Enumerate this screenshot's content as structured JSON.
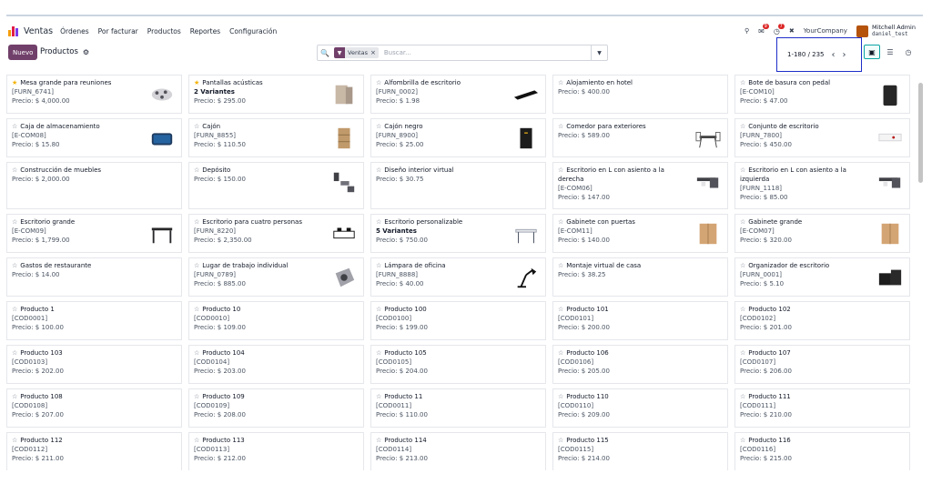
{
  "navbar": {
    "brand": "Ventas",
    "menu": [
      "Órdenes",
      "Por facturar",
      "Productos",
      "Reportes",
      "Configuración"
    ],
    "company": "YourCompany",
    "user_name": "Mitchell Admin",
    "db_name": "daniel_test",
    "chat_count": "9",
    "activity_count": "7"
  },
  "control": {
    "new_label": "Nuevo",
    "breadcrumb": "Productos",
    "facet_label": "Ventas",
    "search_placeholder": "Buscar...",
    "pager": "1-180 / 235"
  },
  "colors": {
    "accent": "#71406a",
    "favorite": "#f3b200",
    "pager_highlight": "#1d2ec9"
  },
  "products": [
    {
      "name": "Mesa grande para reuniones",
      "sub": "[FURN_6741]",
      "price": "Precio: $ 4,000.00",
      "fav": true,
      "thumb": "meeting-table"
    },
    {
      "name": "Pantallas acústicas",
      "sub": "2 Variantes",
      "sub_bold": true,
      "price": "Precio: $ 295.00",
      "fav": true,
      "thumb": "acoustic-panel"
    },
    {
      "name": "Alfombrilla de escritorio",
      "sub": "[FURN_0002]",
      "price": "Precio: $ 1.98",
      "thumb": "desk-pad"
    },
    {
      "name": "Alojamiento en hotel",
      "sub": "",
      "price": "Precio: $ 400.00",
      "thumb": ""
    },
    {
      "name": "Bote de basura con pedal",
      "sub": "[E-COM10]",
      "price": "Precio: $ 47.00",
      "thumb": "trash-can"
    },
    {
      "name": "Caja de almacenamiento",
      "sub": "[E-COM08]",
      "price": "Precio: $ 15.80",
      "thumb": "storage-box"
    },
    {
      "name": "Cajón",
      "sub": "[FURN_8855]",
      "price": "Precio: $ 110.50",
      "thumb": "drawer"
    },
    {
      "name": "Cajón negro",
      "sub": "[FURN_8900]",
      "price": "Precio: $ 25.00",
      "thumb": "black-drawer"
    },
    {
      "name": "Comedor para exteriores",
      "sub": "",
      "price": "Precio: $ 589.00",
      "thumb": "outdoor-dining"
    },
    {
      "name": "Conjunto de escritorio",
      "sub": "[FURN_7800]",
      "price": "Precio: $ 450.00",
      "thumb": "desk-set"
    },
    {
      "name": "Construcción de muebles",
      "sub": "",
      "price": "Precio: $ 2,000.00",
      "thumb": ""
    },
    {
      "name": "Depósito",
      "sub": "",
      "price": "Precio: $ 150.00",
      "thumb": "deposit"
    },
    {
      "name": "Diseño interior virtual",
      "sub": "",
      "price": "Precio: $ 30.75",
      "thumb": ""
    },
    {
      "name": "Escritorio en L con asiento a la derecha",
      "sub": "[E-COM06]",
      "price": "Precio: $ 147.00",
      "thumb": "l-desk",
      "tall": true
    },
    {
      "name": "Escritorio en L con asiento a la izquierda",
      "sub": "[FURN_1118]",
      "price": "Precio: $ 85.00",
      "thumb": "l-desk",
      "tall": true
    },
    {
      "name": "Escritorio grande",
      "sub": "[E-COM09]",
      "price": "Precio: $ 1,799.00",
      "thumb": "large-desk"
    },
    {
      "name": "Escritorio para cuatro personas",
      "sub": "[FURN_8220]",
      "price": "Precio: $ 2,350.00",
      "thumb": "four-desk"
    },
    {
      "name": "Escritorio personalizable",
      "sub": "5 Variantes",
      "sub_bold": true,
      "price": "Precio: $ 750.00",
      "thumb": "custom-desk"
    },
    {
      "name": "Gabinete con puertas",
      "sub": "[E-COM11]",
      "price": "Precio: $ 140.00",
      "thumb": "cabinet"
    },
    {
      "name": "Gabinete grande",
      "sub": "[E-COM07]",
      "price": "Precio: $ 320.00",
      "thumb": "cabinet"
    },
    {
      "name": "Gastos de restaurante",
      "sub": "",
      "price": "Precio: $ 14.00",
      "thumb": ""
    },
    {
      "name": "Lugar de trabajo individual",
      "sub": "[FURN_0789]",
      "price": "Precio: $ 885.00",
      "thumb": "workstation"
    },
    {
      "name": "Lámpara de oficina",
      "sub": "[FURN_8888]",
      "price": "Precio: $ 40.00",
      "thumb": "lamp"
    },
    {
      "name": "Montaje virtual de casa",
      "sub": "",
      "price": "Precio: $ 38.25",
      "thumb": ""
    },
    {
      "name": "Organizador de escritorio",
      "sub": "[FURN_0001]",
      "price": "Precio: $ 5.10",
      "thumb": "organizer"
    },
    {
      "name": "Producto 1",
      "sub": "[COD0001]",
      "price": "Precio: $ 100.00",
      "thumb": ""
    },
    {
      "name": "Producto 10",
      "sub": "[COD0010]",
      "price": "Precio: $ 109.00",
      "thumb": ""
    },
    {
      "name": "Producto 100",
      "sub": "[COD0100]",
      "price": "Precio: $ 199.00",
      "thumb": ""
    },
    {
      "name": "Producto 101",
      "sub": "[COD0101]",
      "price": "Precio: $ 200.00",
      "thumb": ""
    },
    {
      "name": "Producto 102",
      "sub": "[COD0102]",
      "price": "Precio: $ 201.00",
      "thumb": ""
    },
    {
      "name": "Producto 103",
      "sub": "[COD0103]",
      "price": "Precio: $ 202.00",
      "thumb": ""
    },
    {
      "name": "Producto 104",
      "sub": "[COD0104]",
      "price": "Precio: $ 203.00",
      "thumb": ""
    },
    {
      "name": "Producto 105",
      "sub": "[COD0105]",
      "price": "Precio: $ 204.00",
      "thumb": ""
    },
    {
      "name": "Producto 106",
      "sub": "[COD0106]",
      "price": "Precio: $ 205.00",
      "thumb": ""
    },
    {
      "name": "Producto 107",
      "sub": "[COD0107]",
      "price": "Precio: $ 206.00",
      "thumb": ""
    },
    {
      "name": "Producto 108",
      "sub": "[COD0108]",
      "price": "Precio: $ 207.00",
      "thumb": ""
    },
    {
      "name": "Producto 109",
      "sub": "[COD0109]",
      "price": "Precio: $ 208.00",
      "thumb": ""
    },
    {
      "name": "Producto 11",
      "sub": "[COD0011]",
      "price": "Precio: $ 110.00",
      "thumb": ""
    },
    {
      "name": "Producto 110",
      "sub": "[COD0110]",
      "price": "Precio: $ 209.00",
      "thumb": ""
    },
    {
      "name": "Producto 111",
      "sub": "[COD0111]",
      "price": "Precio: $ 210.00",
      "thumb": ""
    },
    {
      "name": "Producto 112",
      "sub": "[COD0112]",
      "price": "Precio: $ 211.00",
      "thumb": ""
    },
    {
      "name": "Producto 113",
      "sub": "[COD0113]",
      "price": "Precio: $ 212.00",
      "thumb": ""
    },
    {
      "name": "Producto 114",
      "sub": "[COD0114]",
      "price": "Precio: $ 213.00",
      "thumb": ""
    },
    {
      "name": "Producto 115",
      "sub": "[COD0115]",
      "price": "Precio: $ 214.00",
      "thumb": ""
    },
    {
      "name": "Producto 116",
      "sub": "[COD0116]",
      "price": "Precio: $ 215.00",
      "thumb": ""
    }
  ]
}
